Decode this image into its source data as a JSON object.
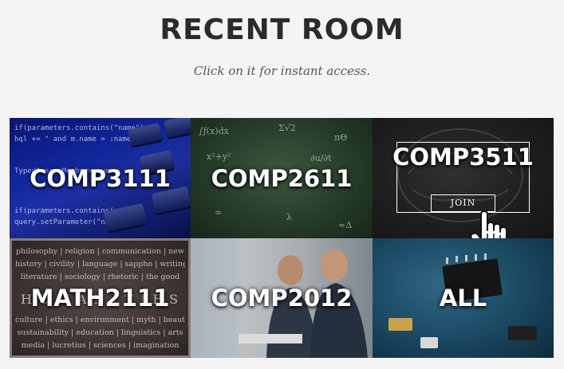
{
  "header": {
    "title": "RECENT ROOM",
    "subtitle": "Click on it for instant access."
  },
  "rooms": [
    {
      "label": "COMP3111"
    },
    {
      "label": "COMP2611"
    },
    {
      "label": "COMP3511",
      "join_label": "JOIN"
    },
    {
      "label": "MATH2111"
    },
    {
      "label": "COMP2012"
    },
    {
      "label": "ALL"
    }
  ],
  "decorations": {
    "code_lines": [
      "if(parameters.contains(\"name\")",
      "hql += \" and m.name = :name\"",
      "TypedQuery<Member> query",
      "if(parameters.contains(",
      "query.setParameter(\"name\""
    ],
    "chalk_symbols": [
      "∫ƒ(x)dx",
      "Σ√2",
      "πΘ",
      "x²+y²",
      "∂u/∂t",
      "∞",
      "λ",
      "≈Δ"
    ],
    "word_rows": [
      "philosophy | religion | communication | new",
      "history | civility | language | sappho | writing",
      "literature | sociology | rhetoric | the good",
      "H  U  M  A  N  I  T  I  E  S",
      "culture | ethics | environment | myth | beauty",
      "sustainability | education | linguistics | arts",
      "media | lucretius | sciences | imagination"
    ]
  },
  "colors": {
    "background": "#f4f4f4",
    "title": "#2b2b2b",
    "subtitle": "#555555",
    "label": "#ffffff"
  }
}
